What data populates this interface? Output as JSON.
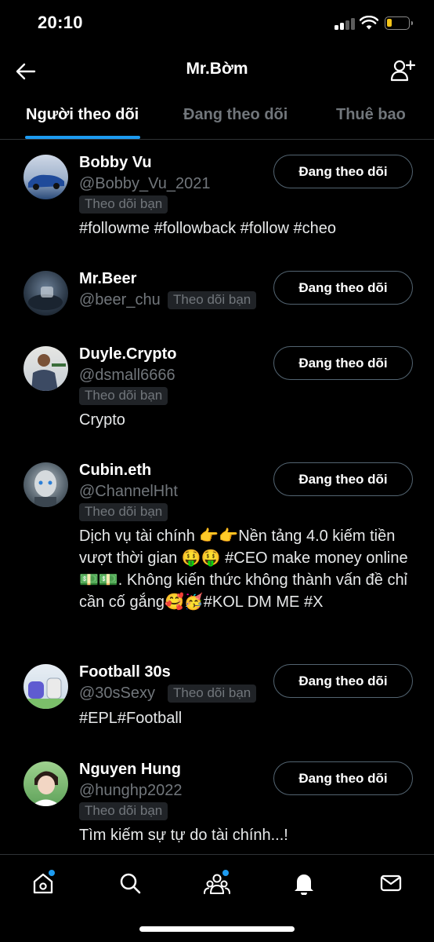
{
  "status_bar": {
    "time": "20:10"
  },
  "header": {
    "title": "Mr.Bờm"
  },
  "tabs": [
    {
      "label": "Người theo dõi",
      "active": true
    },
    {
      "label": "Đang theo dõi",
      "active": false
    },
    {
      "label": "Thuê bao",
      "active": false
    }
  ],
  "users": [
    {
      "name": "Bobby Vu",
      "handle": "@Bobby_Vu_2021",
      "badge": "Theo dõi bạn",
      "bio": "#followme #followback #follow #cheo",
      "button": "Đang theo dõi"
    },
    {
      "name": "Mr.Beer",
      "handle": "@beer_chu",
      "badge": "Theo dõi bạn",
      "bio": "",
      "button": "Đang theo dõi"
    },
    {
      "name": "Duyle.Crypto",
      "handle": "@dsmall6666",
      "badge": "Theo dõi bạn",
      "bio": "Crypto",
      "button": "Đang theo dõi"
    },
    {
      "name": "Cubin.eth",
      "handle": "@ChannelHht",
      "badge": "Theo dõi bạn",
      "bio": "Dịch vụ tài chính 👉👉Nền tảng 4.0 kiếm tiền vượt thời gian 🤑🤑 #CEO make money online💵💵. Không kiến thức không thành vấn đề chỉ cần cố gắng🥰🥳#KOL DM ME #X",
      "button": "Đang theo dõi"
    },
    {
      "name": "Football 30s",
      "handle": "@30sSexy",
      "badge": "Theo dõi bạn",
      "bio": "#EPL#Football",
      "button": "Đang theo dõi"
    },
    {
      "name": "Nguyen Hung",
      "handle": "@hunghp2022",
      "badge": "Theo dõi bạn",
      "bio": "Tìm kiếm sự tự do tài chính...!",
      "button": "Đang theo dõi"
    }
  ],
  "bottom_nav": [
    {
      "icon": "home-icon",
      "has_dot": true
    },
    {
      "icon": "search-icon",
      "has_dot": false
    },
    {
      "icon": "communities-icon",
      "has_dot": true
    },
    {
      "icon": "bell-icon",
      "has_dot": false
    },
    {
      "icon": "mail-icon",
      "has_dot": false
    }
  ],
  "colors": {
    "accent": "#1d9bf0",
    "background": "#000000",
    "muted": "#71767b",
    "battery": "#f5c518"
  }
}
